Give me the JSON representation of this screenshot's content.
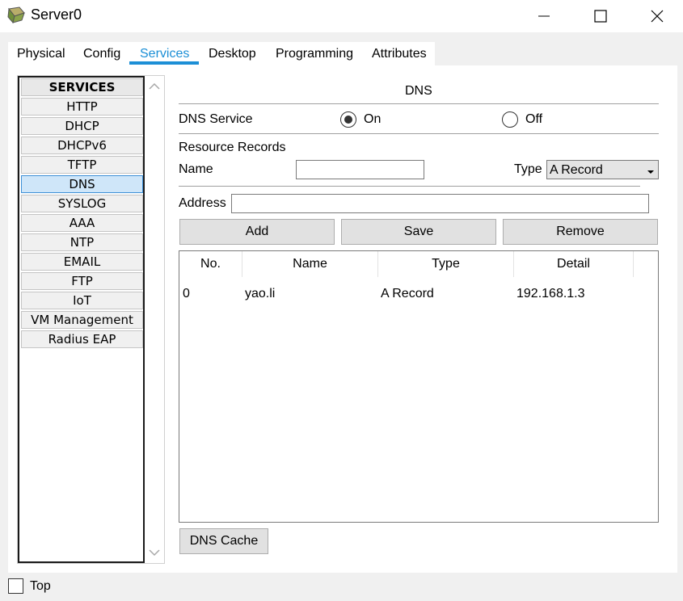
{
  "window": {
    "title": "Server0"
  },
  "tabs": [
    {
      "label": "Physical",
      "active": false
    },
    {
      "label": "Config",
      "active": false
    },
    {
      "label": "Services",
      "active": true
    },
    {
      "label": "Desktop",
      "active": false
    },
    {
      "label": "Programming",
      "active": false
    },
    {
      "label": "Attributes",
      "active": false
    }
  ],
  "sidebar": {
    "header": "SERVICES",
    "items": [
      "HTTP",
      "DHCP",
      "DHCPv6",
      "TFTP",
      "DNS",
      "SYSLOG",
      "AAA",
      "NTP",
      "EMAIL",
      "FTP",
      "IoT",
      "VM Management",
      "Radius EAP"
    ],
    "selected": "DNS"
  },
  "dns": {
    "title": "DNS",
    "service_label": "DNS Service",
    "on_label": "On",
    "off_label": "Off",
    "service_state": "On",
    "resource_records_label": "Resource Records",
    "name_label": "Name",
    "name_value": "",
    "type_label": "Type",
    "type_value": "A Record",
    "address_label": "Address",
    "address_value": "",
    "add_button": "Add",
    "save_button": "Save",
    "remove_button": "Remove",
    "cache_button": "DNS Cache"
  },
  "records": {
    "columns": [
      "No.",
      "Name",
      "Type",
      "Detail"
    ],
    "rows": [
      {
        "no": "0",
        "name": "yao.li",
        "type": "A Record",
        "detail": "192.168.1.3"
      }
    ]
  },
  "footer": {
    "top_label": "Top",
    "top_checked": false
  },
  "colors": {
    "accent": "#1c8fd6",
    "selected_bg": "#cfe6f9"
  }
}
